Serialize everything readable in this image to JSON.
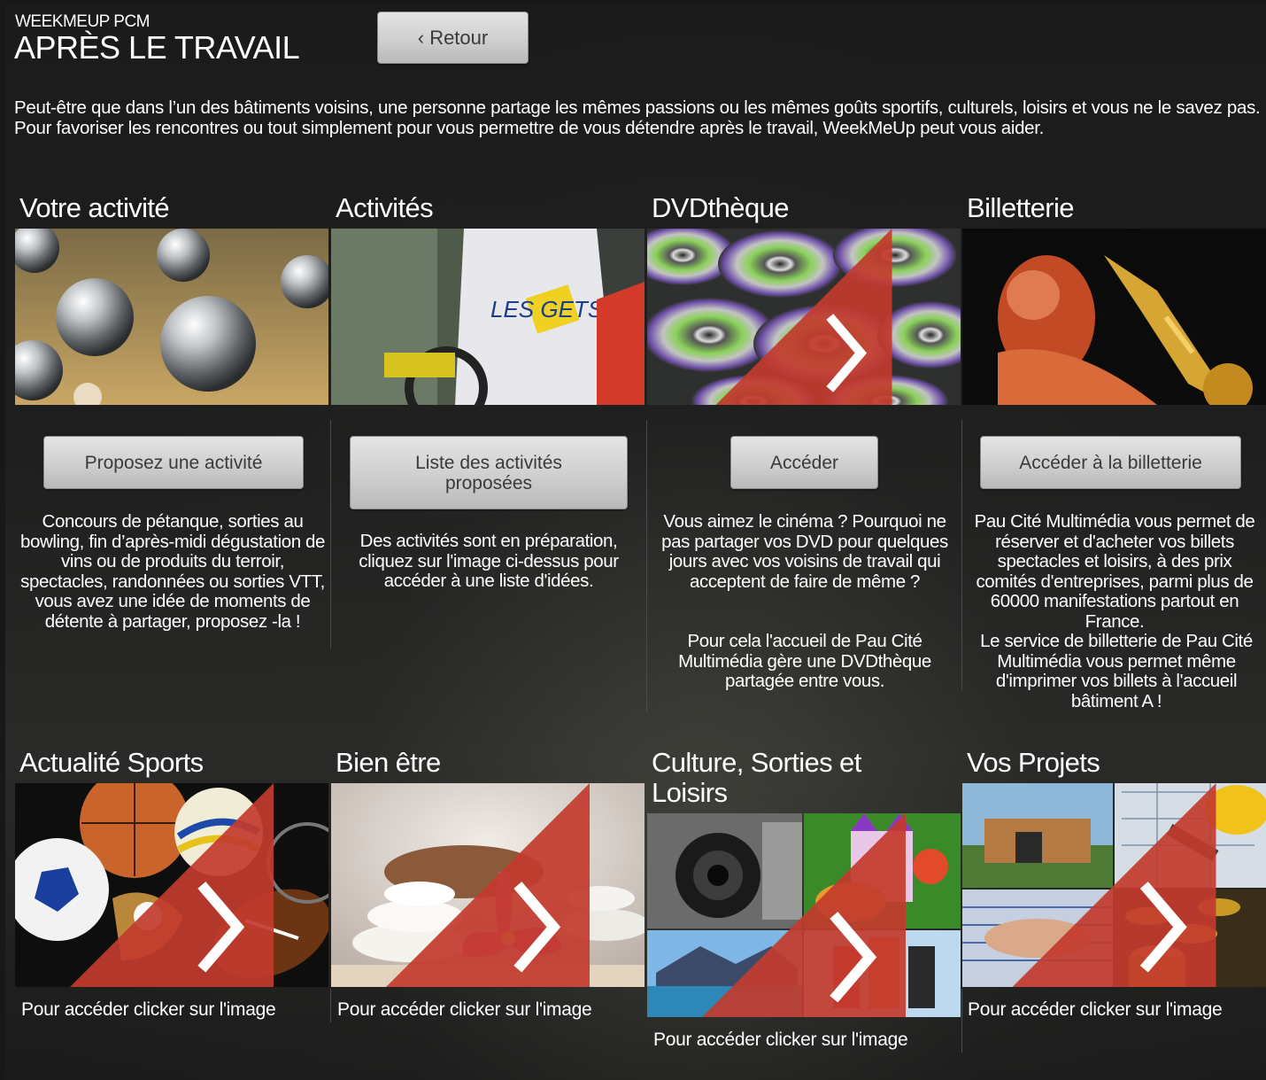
{
  "header": {
    "app_name": "WEEKMEUP PCM",
    "title": "APRÈS LE TRAVAIL",
    "back_label": "‹ Retour"
  },
  "intro": "Peut-être que dans l’un des bâtiments voisins, une personne partage les mêmes passions ou les mêmes goûts sportifs, culturels, loisirs et vous ne le savez pas. Pour favoriser les rencontres ou tout simplement pour vous permettre de vous détendre après le travail, WeekMeUp peut vous aider.",
  "row1": [
    {
      "title": "Votre activité",
      "image": "petanque-balls",
      "button": "Proposez une activité",
      "description": "Concours de pétanque, sorties au bowling, fin d’après-midi dégustation de vins ou de produits du terroir, spectacles, randonnées ou sorties VTT, vous avez une idée de moments de détente à partager, proposez -la !"
    },
    {
      "title": "Activités",
      "image": "bike-race",
      "button": "Liste des activités proposées",
      "description": "Des activités sont en préparation, cliquez sur l'image ci-dessus pour accéder à une liste d'idées."
    },
    {
      "title": "DVDthèque",
      "image": "dvd-discs",
      "button": "Accéder",
      "description": "Vous aimez le cinéma ? Pourquoi ne pas partager vos DVD pour quelques jours avec vos voisins de travail qui acceptent de faire de même ?",
      "description2": "Pour cela l'accueil de Pau Cité Multimédia gère une DVDthèque partagée entre vous."
    },
    {
      "title": "Billetterie",
      "image": "saxophone-player",
      "button": "Accéder à la billetterie",
      "description": "Pau Cité Multimédia vous permet de réserver et  d'acheter vos billets spectacles et loisirs, à des prix comités d'entreprises, parmi plus de 60000 manifestations partout en France.",
      "description2": "Le service de billetterie de Pau Cité Multimédia vous permet même d'imprimer vos billets à l'accueil bâtiment A !"
    }
  ],
  "row2": [
    {
      "title": "Actualité Sports",
      "image": "sports-balls",
      "caption": "Pour accéder clicker sur l'image"
    },
    {
      "title": "Bien être",
      "image": "spa-stones-orchid",
      "caption": "Pour accéder clicker sur l'image"
    },
    {
      "title": "Culture, Sorties et Loisirs",
      "image": "culture-collage",
      "caption": "Pour accéder clicker sur l'image"
    },
    {
      "title": "Vos Projets",
      "image": "projects-collage",
      "caption": "Pour accéder clicker sur l'image"
    }
  ],
  "colors": {
    "background": "#1b1b1b",
    "button": "#d4d4d4",
    "arrow_badge": "#c0392b"
  },
  "icons": {
    "arrow": "chevron-right-icon"
  }
}
